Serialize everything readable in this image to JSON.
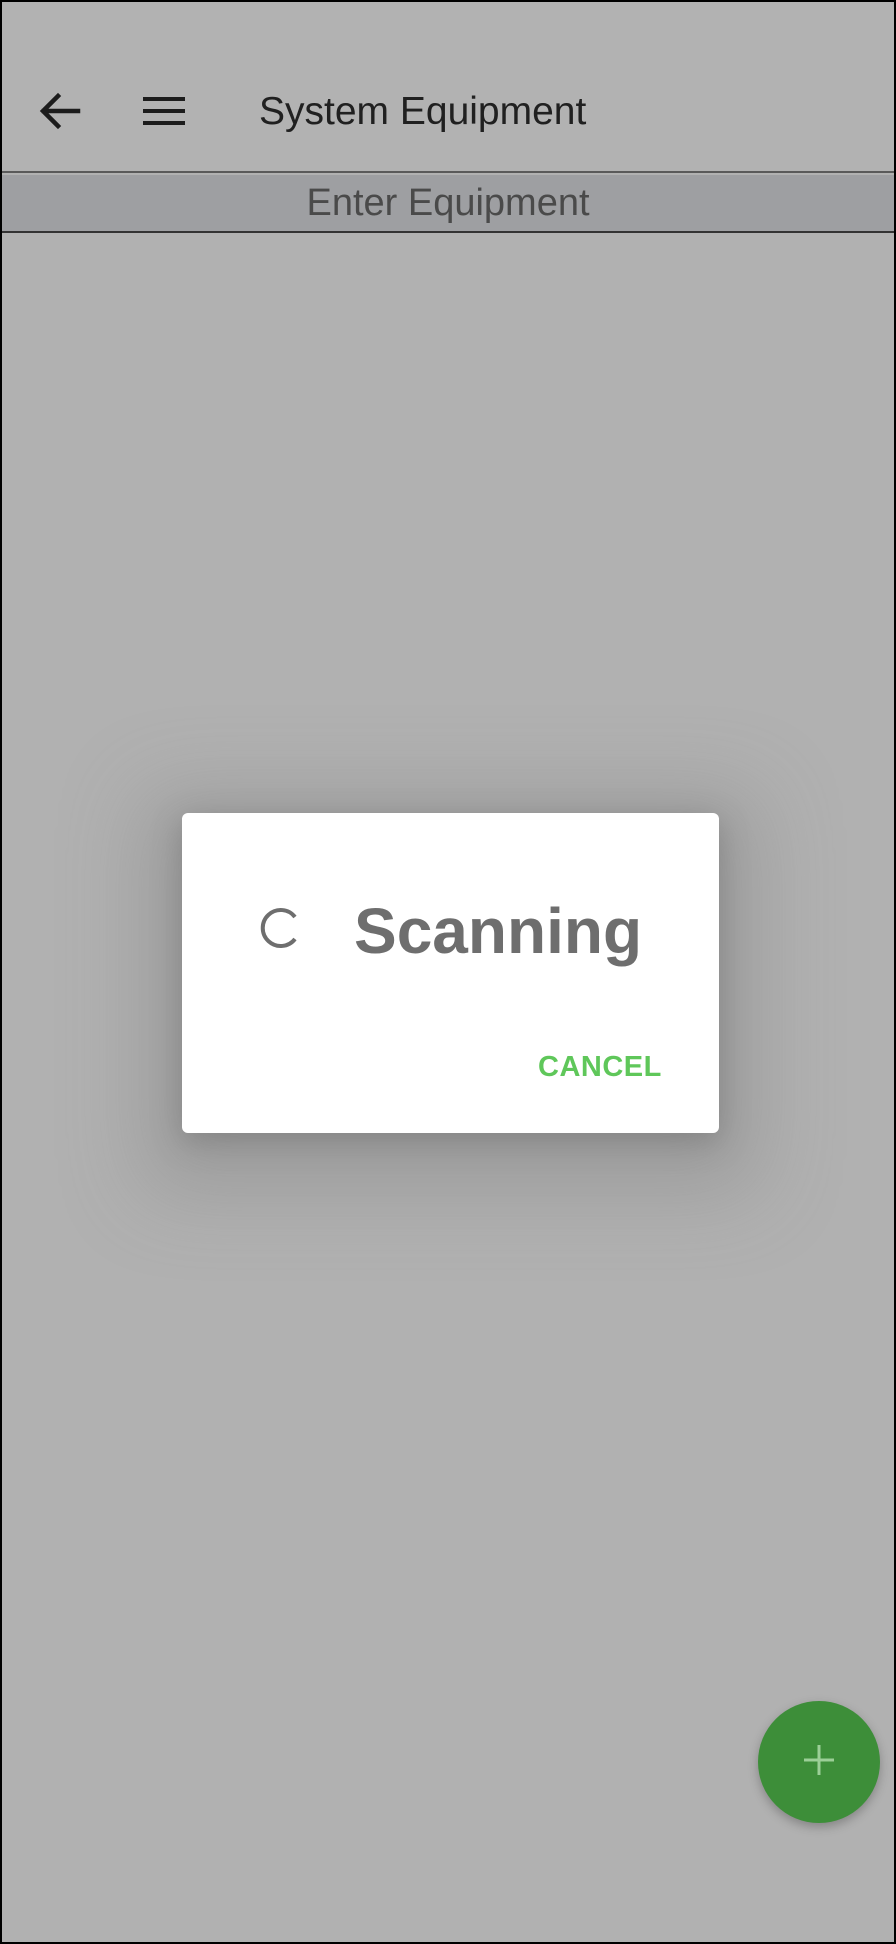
{
  "appbar": {
    "title": "System Equipment",
    "back_icon": "arrow-left-icon",
    "menu_icon": "hamburger-menu-icon"
  },
  "subheader": {
    "label": "Enter Equipment"
  },
  "dialog": {
    "message": "Scanning",
    "spinner_icon": "loading-spinner-icon",
    "cancel_label": "CANCEL"
  },
  "fab": {
    "icon": "plus-icon"
  },
  "colors": {
    "background": "#b1b1b1",
    "subheader_bg": "#9e9fa2",
    "accent_green": "#5fc75a",
    "fab_green": "#3d8e39"
  }
}
